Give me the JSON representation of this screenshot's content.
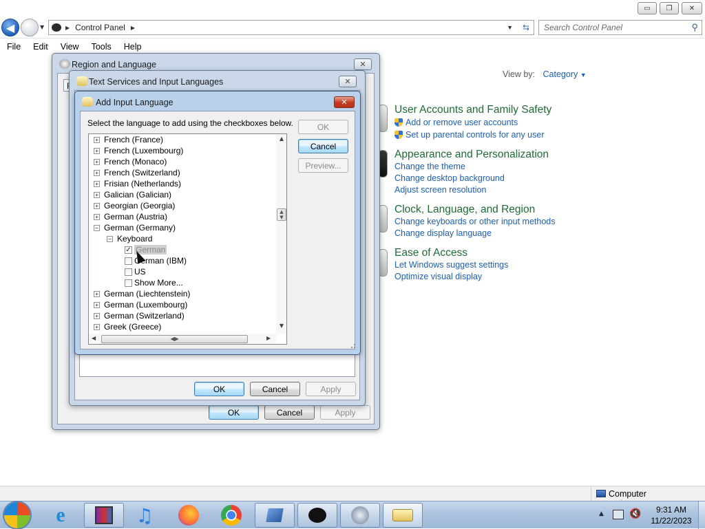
{
  "window": {
    "minimize": "▭",
    "maximize": "❐",
    "close": "✕"
  },
  "nav": {
    "back_icon": "arrow-left-icon",
    "forward_icon": "arrow-right-icon",
    "breadcrumb": "Control Panel",
    "search_placeholder": "Search Control Panel"
  },
  "menu": [
    "File",
    "Edit",
    "View",
    "Tools",
    "Help"
  ],
  "viewby": {
    "label": "View by:",
    "value": "Category"
  },
  "categories": [
    {
      "title": "User Accounts and Family Safety",
      "links": [
        "Add or remove user accounts",
        "Set up parental controls for any user"
      ],
      "shield": [
        true,
        true
      ]
    },
    {
      "title": "Appearance and Personalization",
      "links": [
        "Change the theme",
        "Change desktop background",
        "Adjust screen resolution"
      ]
    },
    {
      "title": "Clock, Language, and Region",
      "links": [
        "Change keyboards or other input methods",
        "Change display language"
      ]
    },
    {
      "title": "Ease of Access",
      "links": [
        "Let Windows suggest settings",
        "Optimize visual display"
      ]
    }
  ],
  "dialogs": {
    "region": {
      "title": "Region and Language",
      "tab_stub": "F",
      "ok": "OK",
      "cancel": "Cancel",
      "apply": "Apply"
    },
    "text_services": {
      "title": "Text Services and Input Languages",
      "ok": "OK",
      "cancel": "Cancel",
      "apply": "Apply"
    },
    "add_language": {
      "title": "Add Input Language",
      "instruction": "Select the language to add using the checkboxes below.",
      "ok": "OK",
      "cancel": "Cancel",
      "preview": "Preview...",
      "tree": [
        {
          "label": "French (France)",
          "level": 0,
          "expander": "+"
        },
        {
          "label": "French (Luxembourg)",
          "level": 0,
          "expander": "+"
        },
        {
          "label": "French (Monaco)",
          "level": 0,
          "expander": "+"
        },
        {
          "label": "French (Switzerland)",
          "level": 0,
          "expander": "+"
        },
        {
          "label": "Frisian (Netherlands)",
          "level": 0,
          "expander": "+"
        },
        {
          "label": "Galician (Galician)",
          "level": 0,
          "expander": "+"
        },
        {
          "label": "Georgian (Georgia)",
          "level": 0,
          "expander": "+"
        },
        {
          "label": "German (Austria)",
          "level": 0,
          "expander": "+"
        },
        {
          "label": "German (Germany)",
          "level": 0,
          "expander": "−"
        },
        {
          "label": "Keyboard",
          "level": 1,
          "expander": "−"
        },
        {
          "label": "German",
          "level": 2,
          "checkbox": true,
          "checked": true,
          "selected": true
        },
        {
          "label": "German (IBM)",
          "level": 2,
          "checkbox": true,
          "checked": false
        },
        {
          "label": "US",
          "level": 2,
          "checkbox": true,
          "checked": false
        },
        {
          "label": "Show More...",
          "level": 2,
          "checkbox": true,
          "checked": false
        },
        {
          "label": "German (Liechtenstein)",
          "level": 0,
          "expander": "+"
        },
        {
          "label": "German (Luxembourg)",
          "level": 0,
          "expander": "+"
        },
        {
          "label": "German (Switzerland)",
          "level": 0,
          "expander": "+"
        },
        {
          "label": "Greek (Greece)",
          "level": 0,
          "expander": "+"
        }
      ]
    }
  },
  "statusbar": {
    "computer_label": "Computer"
  },
  "taskbar": {
    "time": "9:31 AM",
    "date": "11/22/2023",
    "apps": [
      "start-orb-icon",
      "internet-explorer-icon",
      "winrar-icon",
      "itunes-icon",
      "firefox-icon",
      "chrome-icon",
      "system-app-icon",
      "black-app-icon",
      "disk-utility-icon",
      "keyboard-app-icon"
    ]
  },
  "colors": {
    "link": "#1c5eb5",
    "category_title": "#1e6b33",
    "accent_close": "#c3391a"
  }
}
